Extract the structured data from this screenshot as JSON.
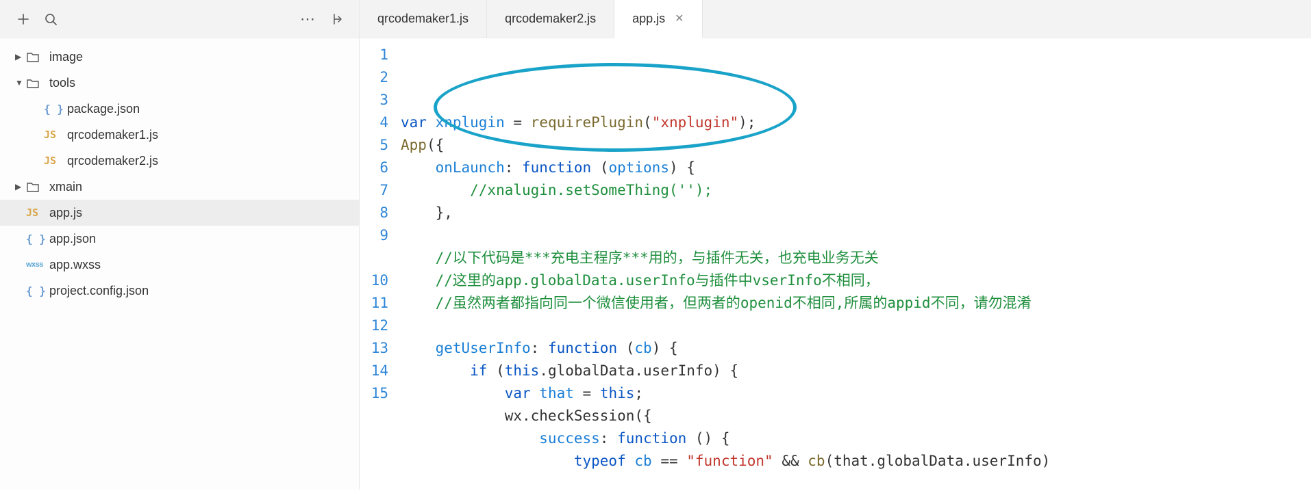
{
  "sidebar": {
    "toolbar": {
      "add": "+",
      "search": "search",
      "more": "⋯",
      "collapse": "collapse"
    },
    "tree": [
      {
        "kind": "folder",
        "label": "image",
        "level": 0,
        "expanded": false
      },
      {
        "kind": "folder",
        "label": "tools",
        "level": 0,
        "expanded": true
      },
      {
        "kind": "json",
        "label": "package.json",
        "level": 1
      },
      {
        "kind": "js",
        "label": "qrcodemaker1.js",
        "level": 1
      },
      {
        "kind": "js",
        "label": "qrcodemaker2.js",
        "level": 1
      },
      {
        "kind": "folder",
        "label": "xmain",
        "level": 0,
        "expanded": false
      },
      {
        "kind": "js",
        "label": "app.js",
        "level": 0,
        "selected": true
      },
      {
        "kind": "json",
        "label": "app.json",
        "level": 0
      },
      {
        "kind": "wxss",
        "label": "app.wxss",
        "level": 0
      },
      {
        "kind": "json",
        "label": "project.config.json",
        "level": 0
      }
    ]
  },
  "tabs": [
    {
      "label": "qrcodemaker1.js",
      "active": false
    },
    {
      "label": "qrcodemaker2.js",
      "active": false
    },
    {
      "label": "app.js",
      "active": true,
      "closable": true
    }
  ],
  "code": {
    "lines": [
      {
        "n": 1,
        "segments": [
          {
            "t": "var ",
            "c": "tok-kw"
          },
          {
            "t": "xnplugin",
            "c": "tok-var"
          },
          {
            "t": " = ",
            "c": "tok-punct"
          },
          {
            "t": "requirePlugin",
            "c": "tok-fn"
          },
          {
            "t": "(",
            "c": "tok-punct"
          },
          {
            "t": "\"xnplugin\"",
            "c": "tok-str"
          },
          {
            "t": ");",
            "c": "tok-punct"
          }
        ]
      },
      {
        "n": 2,
        "segments": [
          {
            "t": "App",
            "c": "tok-fn"
          },
          {
            "t": "({",
            "c": "tok-punct"
          }
        ]
      },
      {
        "n": 3,
        "segments": [
          {
            "t": "    onLaunch",
            "c": "tok-var"
          },
          {
            "t": ": ",
            "c": "tok-punct"
          },
          {
            "t": "function ",
            "c": "tok-kw"
          },
          {
            "t": "(",
            "c": "tok-punct"
          },
          {
            "t": "options",
            "c": "tok-var"
          },
          {
            "t": ") {",
            "c": "tok-punct"
          }
        ]
      },
      {
        "n": 4,
        "segments": [
          {
            "t": "        //xnalugin.setSomeThing('');",
            "c": "tok-com"
          }
        ]
      },
      {
        "n": 5,
        "segments": [
          {
            "t": "    },",
            "c": "tok-punct"
          }
        ]
      },
      {
        "n": 6,
        "segments": [
          {
            "t": "",
            "c": ""
          }
        ]
      },
      {
        "n": 7,
        "segments": [
          {
            "t": "    //以下代码是***充电主程序***用的，与插件无关，也充电业务无关",
            "c": "tok-com"
          }
        ]
      },
      {
        "n": 8,
        "segments": [
          {
            "t": "    //这里的app.globalData.userInfo与插件中vserInfo不相同，",
            "c": "tok-com"
          }
        ]
      },
      {
        "n": 9,
        "wrap": true,
        "segments": [
          {
            "t": "    //虽然两者都指向同一个微信使用者，但两者的openid不相同,所属的appid不同，请勿混淆",
            "c": "tok-com"
          }
        ]
      },
      {
        "n": 10,
        "segments": [
          {
            "t": "    getUserInfo",
            "c": "tok-var"
          },
          {
            "t": ": ",
            "c": "tok-punct"
          },
          {
            "t": "function ",
            "c": "tok-kw"
          },
          {
            "t": "(",
            "c": "tok-punct"
          },
          {
            "t": "cb",
            "c": "tok-var"
          },
          {
            "t": ") {",
            "c": "tok-punct"
          }
        ]
      },
      {
        "n": 11,
        "segments": [
          {
            "t": "        if ",
            "c": "tok-kw"
          },
          {
            "t": "(",
            "c": "tok-punct"
          },
          {
            "t": "this",
            "c": "tok-kw"
          },
          {
            "t": ".globalData.userInfo) {",
            "c": "tok-punct"
          }
        ]
      },
      {
        "n": 12,
        "segments": [
          {
            "t": "            var ",
            "c": "tok-kw"
          },
          {
            "t": "that",
            "c": "tok-var"
          },
          {
            "t": " = ",
            "c": "tok-punct"
          },
          {
            "t": "this",
            "c": "tok-kw"
          },
          {
            "t": ";",
            "c": "tok-punct"
          }
        ]
      },
      {
        "n": 13,
        "segments": [
          {
            "t": "            wx.checkSession({",
            "c": "tok-punct"
          }
        ]
      },
      {
        "n": 14,
        "segments": [
          {
            "t": "                success",
            "c": "tok-var"
          },
          {
            "t": ": ",
            "c": "tok-punct"
          },
          {
            "t": "function ",
            "c": "tok-kw"
          },
          {
            "t": "() {",
            "c": "tok-punct"
          }
        ]
      },
      {
        "n": 15,
        "segments": [
          {
            "t": "                    typeof ",
            "c": "tok-kw"
          },
          {
            "t": "cb",
            "c": "tok-var"
          },
          {
            "t": " == ",
            "c": "tok-punct"
          },
          {
            "t": "\"function\"",
            "c": "tok-str"
          },
          {
            "t": " && ",
            "c": "tok-punct"
          },
          {
            "t": "cb",
            "c": "tok-fn"
          },
          {
            "t": "(that.globalData.userInfo)",
            "c": "tok-punct"
          }
        ]
      }
    ]
  }
}
